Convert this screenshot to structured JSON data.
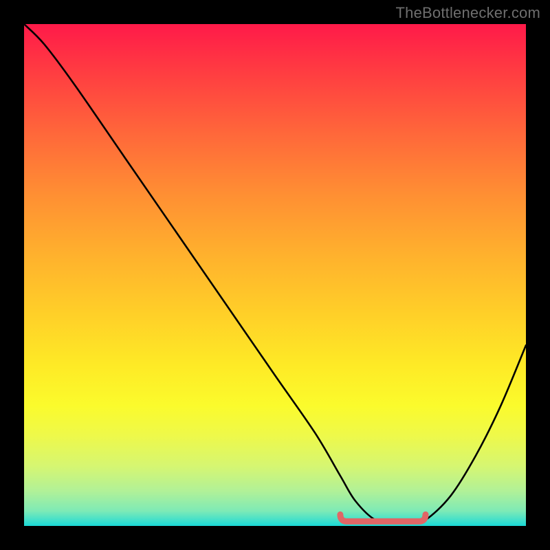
{
  "branding": {
    "label": "TheBottlenecker.com"
  },
  "chart_data": {
    "type": "line",
    "title": "",
    "xlabel": "",
    "ylabel": "",
    "xlim": [
      0,
      100
    ],
    "ylim": [
      0,
      100
    ],
    "x": [
      0,
      4,
      10,
      20,
      30,
      40,
      50,
      58,
      63,
      66,
      70,
      74,
      77,
      80,
      85,
      90,
      95,
      100
    ],
    "values": [
      100,
      96,
      88,
      73.5,
      59,
      44.5,
      30,
      18.5,
      10,
      5,
      1.2,
      0.6,
      0.6,
      1.2,
      6,
      14,
      24,
      36
    ],
    "flat_region": {
      "x_start": 63,
      "x_end": 80,
      "y": 0.9
    },
    "gradient_colors": {
      "top": "#ff1a49",
      "mid": "#ffd028",
      "bottom": "#1ad9d6"
    }
  }
}
